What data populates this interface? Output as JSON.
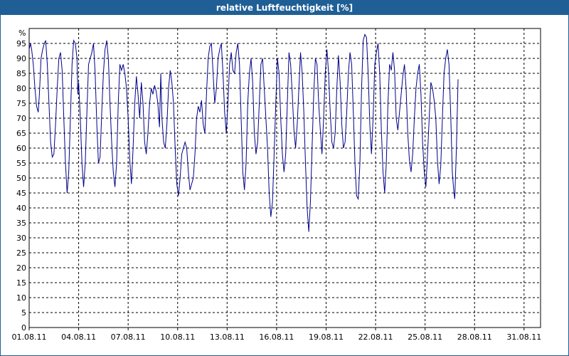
{
  "window": {
    "title": "relative Luftfeuchtigkeit [%]"
  },
  "chart_data": {
    "type": "line",
    "title": "relative Luftfeuchtigkeit [%]",
    "ylabel": "%",
    "ylim": [
      0,
      100
    ],
    "yticks": [
      0,
      5,
      10,
      15,
      20,
      25,
      30,
      35,
      40,
      45,
      50,
      55,
      60,
      65,
      70,
      75,
      80,
      85,
      90,
      95
    ],
    "xlim": [
      "01.08.11 00:00",
      "01.09.11 00:00"
    ],
    "xtick_labels": [
      "01.08.11",
      "04.08.11",
      "07.08.11",
      "10.08.11",
      "13.08.11",
      "16.08.11",
      "19.08.11",
      "22.08.11",
      "25.08.11",
      "28.08.11",
      "31.08.11"
    ],
    "grid": true,
    "line_color": "#00008b",
    "series": [
      {
        "x_unit": "days since 01.08.11 00:00",
        "points": [
          [
            0.0,
            93
          ],
          [
            0.08,
            95
          ],
          [
            0.15,
            93
          ],
          [
            0.25,
            88
          ],
          [
            0.35,
            80
          ],
          [
            0.45,
            74
          ],
          [
            0.55,
            72
          ],
          [
            0.62,
            78
          ],
          [
            0.72,
            90
          ],
          [
            0.82,
            93
          ],
          [
            0.92,
            95
          ],
          [
            1.0,
            96
          ],
          [
            1.1,
            88
          ],
          [
            1.2,
            75
          ],
          [
            1.3,
            62
          ],
          [
            1.4,
            57
          ],
          [
            1.5,
            58
          ],
          [
            1.6,
            68
          ],
          [
            1.7,
            80
          ],
          [
            1.8,
            90
          ],
          [
            1.9,
            92
          ],
          [
            2.0,
            86
          ],
          [
            2.1,
            70
          ],
          [
            2.2,
            55
          ],
          [
            2.3,
            45
          ],
          [
            2.4,
            52
          ],
          [
            2.5,
            70
          ],
          [
            2.6,
            88
          ],
          [
            2.7,
            96
          ],
          [
            2.8,
            95
          ],
          [
            2.9,
            90
          ],
          [
            2.95,
            78
          ],
          [
            3.0,
            82
          ],
          [
            3.1,
            70
          ],
          [
            3.2,
            55
          ],
          [
            3.3,
            47
          ],
          [
            3.4,
            55
          ],
          [
            3.5,
            72
          ],
          [
            3.6,
            88
          ],
          [
            3.7,
            90
          ],
          [
            3.8,
            92
          ],
          [
            3.9,
            95
          ],
          [
            4.0,
            85
          ],
          [
            4.1,
            68
          ],
          [
            4.2,
            55
          ],
          [
            4.3,
            57
          ],
          [
            4.4,
            72
          ],
          [
            4.5,
            85
          ],
          [
            4.6,
            93
          ],
          [
            4.7,
            96
          ],
          [
            4.8,
            90
          ],
          [
            4.9,
            75
          ],
          [
            5.0,
            62
          ],
          [
            5.1,
            52
          ],
          [
            5.2,
            47
          ],
          [
            5.3,
            55
          ],
          [
            5.4,
            75
          ],
          [
            5.5,
            88
          ],
          [
            5.6,
            86
          ],
          [
            5.7,
            88
          ],
          [
            5.8,
            85
          ],
          [
            5.9,
            80
          ],
          [
            6.0,
            70
          ],
          [
            6.1,
            56
          ],
          [
            6.2,
            48
          ],
          [
            6.3,
            60
          ],
          [
            6.4,
            75
          ],
          [
            6.5,
            84
          ],
          [
            6.6,
            78
          ],
          [
            6.7,
            70
          ],
          [
            6.8,
            82
          ],
          [
            6.9,
            75
          ],
          [
            7.0,
            62
          ],
          [
            7.1,
            58
          ],
          [
            7.2,
            65
          ],
          [
            7.3,
            75
          ],
          [
            7.4,
            80
          ],
          [
            7.5,
            78
          ],
          [
            7.6,
            81
          ],
          [
            7.7,
            79
          ],
          [
            7.8,
            75
          ],
          [
            7.9,
            67
          ],
          [
            7.98,
            85
          ],
          [
            8.05,
            70
          ],
          [
            8.15,
            62
          ],
          [
            8.25,
            60
          ],
          [
            8.35,
            68
          ],
          [
            8.45,
            80
          ],
          [
            8.55,
            86
          ],
          [
            8.65,
            82
          ],
          [
            8.75,
            75
          ],
          [
            8.85,
            60
          ],
          [
            8.95,
            48
          ],
          [
            9.05,
            44
          ],
          [
            9.15,
            50
          ],
          [
            9.25,
            58
          ],
          [
            9.35,
            60
          ],
          [
            9.45,
            62
          ],
          [
            9.55,
            60
          ],
          [
            9.65,
            52
          ],
          [
            9.75,
            46
          ],
          [
            9.85,
            48
          ],
          [
            9.95,
            50
          ],
          [
            10.05,
            58
          ],
          [
            10.15,
            70
          ],
          [
            10.25,
            74
          ],
          [
            10.35,
            72
          ],
          [
            10.45,
            76
          ],
          [
            10.55,
            68
          ],
          [
            10.65,
            65
          ],
          [
            10.75,
            78
          ],
          [
            10.85,
            90
          ],
          [
            10.95,
            94
          ],
          [
            11.05,
            95
          ],
          [
            11.15,
            85
          ],
          [
            11.25,
            75
          ],
          [
            11.35,
            80
          ],
          [
            11.45,
            90
          ],
          [
            11.55,
            93
          ],
          [
            11.65,
            95
          ],
          [
            11.75,
            85
          ],
          [
            11.85,
            72
          ],
          [
            11.95,
            65
          ],
          [
            12.05,
            75
          ],
          [
            12.15,
            88
          ],
          [
            12.25,
            92
          ],
          [
            12.35,
            86
          ],
          [
            12.45,
            85
          ],
          [
            12.55,
            92
          ],
          [
            12.65,
            95
          ],
          [
            12.75,
            88
          ],
          [
            12.85,
            70
          ],
          [
            12.95,
            52
          ],
          [
            13.05,
            46
          ],
          [
            13.15,
            55
          ],
          [
            13.25,
            75
          ],
          [
            13.35,
            85
          ],
          [
            13.45,
            90
          ],
          [
            13.55,
            82
          ],
          [
            13.65,
            65
          ],
          [
            13.75,
            58
          ],
          [
            13.85,
            62
          ],
          [
            13.95,
            75
          ],
          [
            14.05,
            88
          ],
          [
            14.15,
            90
          ],
          [
            14.25,
            80
          ],
          [
            14.35,
            70
          ],
          [
            14.45,
            60
          ],
          [
            14.55,
            45
          ],
          [
            14.65,
            37
          ],
          [
            14.75,
            42
          ],
          [
            14.85,
            58
          ],
          [
            14.95,
            75
          ],
          [
            15.05,
            90
          ],
          [
            15.15,
            85
          ],
          [
            15.25,
            70
          ],
          [
            15.35,
            58
          ],
          [
            15.45,
            52
          ],
          [
            15.55,
            58
          ],
          [
            15.65,
            75
          ],
          [
            15.75,
            92
          ],
          [
            15.85,
            88
          ],
          [
            15.95,
            78
          ],
          [
            16.05,
            66
          ],
          [
            16.15,
            60
          ],
          [
            16.25,
            68
          ],
          [
            16.35,
            80
          ],
          [
            16.45,
            92
          ],
          [
            16.55,
            85
          ],
          [
            16.65,
            72
          ],
          [
            16.75,
            55
          ],
          [
            16.85,
            40
          ],
          [
            16.95,
            32
          ],
          [
            17.05,
            42
          ],
          [
            17.15,
            60
          ],
          [
            17.25,
            78
          ],
          [
            17.35,
            90
          ],
          [
            17.45,
            88
          ],
          [
            17.55,
            75
          ],
          [
            17.65,
            66
          ],
          [
            17.75,
            58
          ],
          [
            17.85,
            70
          ],
          [
            17.95,
            85
          ],
          [
            18.05,
            93
          ],
          [
            18.15,
            85
          ],
          [
            18.25,
            72
          ],
          [
            18.35,
            62
          ],
          [
            18.45,
            60
          ],
          [
            18.55,
            65
          ],
          [
            18.65,
            80
          ],
          [
            18.75,
            91
          ],
          [
            18.85,
            82
          ],
          [
            18.95,
            68
          ],
          [
            19.05,
            60
          ],
          [
            19.15,
            62
          ],
          [
            19.25,
            72
          ],
          [
            19.35,
            85
          ],
          [
            19.45,
            92
          ],
          [
            19.55,
            88
          ],
          [
            19.65,
            72
          ],
          [
            19.75,
            55
          ],
          [
            19.85,
            44
          ],
          [
            19.95,
            43
          ],
          [
            20.05,
            55
          ],
          [
            20.15,
            80
          ],
          [
            20.25,
            96
          ],
          [
            20.35,
            98
          ],
          [
            20.45,
            97
          ],
          [
            20.55,
            85
          ],
          [
            20.65,
            68
          ],
          [
            20.75,
            58
          ],
          [
            20.85,
            70
          ],
          [
            20.95,
            88
          ],
          [
            21.05,
            92
          ],
          [
            21.15,
            95
          ],
          [
            21.25,
            85
          ],
          [
            21.35,
            66
          ],
          [
            21.45,
            52
          ],
          [
            21.55,
            45
          ],
          [
            21.65,
            55
          ],
          [
            21.75,
            75
          ],
          [
            21.85,
            88
          ],
          [
            21.95,
            86
          ],
          [
            22.05,
            92
          ],
          [
            22.15,
            86
          ],
          [
            22.25,
            70
          ],
          [
            22.35,
            66
          ],
          [
            22.45,
            72
          ],
          [
            22.55,
            78
          ],
          [
            22.65,
            84
          ],
          [
            22.75,
            88
          ],
          [
            22.85,
            80
          ],
          [
            22.95,
            65
          ],
          [
            23.05,
            56
          ],
          [
            23.15,
            52
          ],
          [
            23.25,
            58
          ],
          [
            23.35,
            70
          ],
          [
            23.45,
            80
          ],
          [
            23.55,
            85
          ],
          [
            23.65,
            88
          ],
          [
            23.75,
            78
          ],
          [
            23.85,
            62
          ],
          [
            23.95,
            52
          ],
          [
            24.05,
            47
          ],
          [
            24.15,
            58
          ],
          [
            24.25,
            70
          ],
          [
            24.35,
            82
          ],
          [
            24.45,
            80
          ],
          [
            24.55,
            76
          ],
          [
            24.65,
            70
          ],
          [
            24.75,
            56
          ],
          [
            24.85,
            48
          ],
          [
            24.95,
            54
          ],
          [
            25.05,
            70
          ],
          [
            25.15,
            85
          ],
          [
            25.25,
            90
          ],
          [
            25.35,
            93
          ],
          [
            25.45,
            88
          ],
          [
            25.55,
            72
          ],
          [
            25.65,
            52
          ],
          [
            25.75,
            45
          ],
          [
            25.8,
            43
          ],
          [
            25.9,
            60
          ],
          [
            26.0,
            83
          ]
        ]
      }
    ]
  }
}
